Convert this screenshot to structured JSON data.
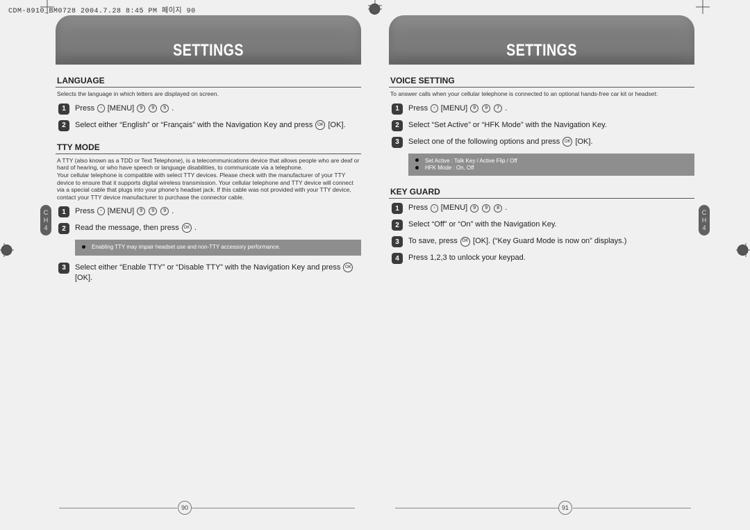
{
  "topline": "CDM-8910_BM0728  2004.7.28 8:45 PM  페이지 90",
  "side_tab": {
    "ch": "C\nH",
    "num": "4"
  },
  "left_page": {
    "banner": "Settings",
    "page_number": "90",
    "sections": {
      "language": {
        "title": "LANGUAGE",
        "desc": "Selects the language in which letters are displayed on screen.",
        "step1_a": "Press ",
        "step1_b": " [MENU] ",
        "step1_keys": [
          "9",
          "9",
          "5"
        ],
        "step1_c": " .",
        "step2": "Select either “English” or “Français” with the Navigation Key and press ",
        "step2_end": " [OK]."
      },
      "tty": {
        "title": "TTY MODE",
        "desc": "A TTY (also known as a TDD or Text Telephone), is a telecommunications device that allows people who are deaf or hard of hearing, or who have speech or language disabilities, to communicate via a telephone.\nYour cellular telephone is compatible with select TTY devices. Please check with the manufacturer of your TTY device to ensure that it supports digital wireless transmission. Your cellular telephone and TTY device will connect via a special cable that plugs into your phone's headset jack. If this cable was not provided with your TTY device, contact your TTY device manufacturer to purchase the connector cable.",
        "step1_a": "Press ",
        "step1_b": " [MENU] ",
        "step1_keys": [
          "9",
          "9",
          "9"
        ],
        "step1_c": " .",
        "step2": "Read the message, then press ",
        "step2_end": " .",
        "info1": "Enabling TTY may impair headset use and non-TTY accessory performance.",
        "step3": "Select either “Enable TTY” or “Disable TTY” with the Navigation Key and press ",
        "step3_end": " [OK]."
      }
    }
  },
  "right_page": {
    "banner": "Settings",
    "page_number": "91",
    "sections": {
      "voice": {
        "title": "VOICE SETTING",
        "desc": "To answer calls when your cellular telephone is connected to an optional hands-free car kit or headset:",
        "step1_a": "Press ",
        "step1_b": " [MENU] ",
        "step1_keys": [
          "9",
          "9",
          "7"
        ],
        "step1_c": " .",
        "step2": "Select “Set Active” or “HFK Mode” with the Navigation Key.",
        "step3": "Select one of the following options and press ",
        "step3_end": " [OK].",
        "info_a": "Set Active : Talk Key / Active Flip / Off",
        "info_b": "HFK Mode : On, Off"
      },
      "keyguard": {
        "title": "KEY GUARD",
        "step1_a": "Press ",
        "step1_b": " [MENU] ",
        "step1_keys": [
          "9",
          "9",
          "8"
        ],
        "step1_c": " .",
        "step2": "Select “Off” or “On” with the Navigation Key.",
        "step3_a": "To save, press ",
        "step3_b": " [OK]. (“Key Guard Mode is now on” displays.)",
        "step4": "Press 1,2,3 to unlock your keypad."
      }
    }
  }
}
